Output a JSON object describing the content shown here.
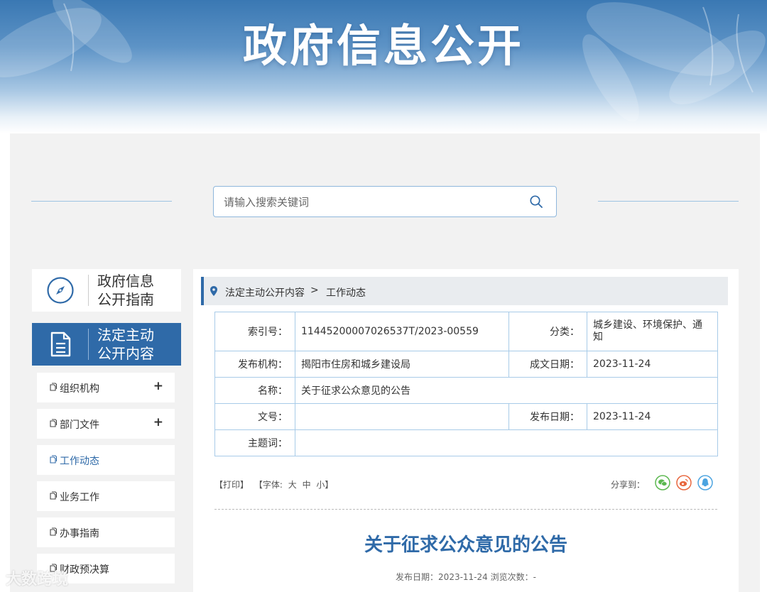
{
  "banner": {
    "title": "政府信息公开"
  },
  "search": {
    "placeholder": "请输入搜索关键词"
  },
  "sidebar": {
    "cards": [
      {
        "label_line1": "政府信息",
        "label_line2": "公开指南"
      },
      {
        "label_line1": "法定主动",
        "label_line2": "公开内容"
      }
    ],
    "items": [
      {
        "label": "组织机构",
        "expand": "+"
      },
      {
        "label": "部门文件",
        "expand": "+"
      },
      {
        "label": "工作动态"
      },
      {
        "label": "业务工作"
      },
      {
        "label": "办事指南"
      },
      {
        "label": "财政预决算"
      }
    ]
  },
  "breadcrumb": {
    "parent": "法定主动公开内容",
    "separator": ">",
    "current": "工作动态"
  },
  "info": {
    "index_label": "索引号：",
    "index_value": "11445200007026537T/2023-00559",
    "category_label": "分类：",
    "category_value": "城乡建设、环境保护、通知",
    "publisher_label": "发布机构：",
    "publisher_value": "揭阳市住房和城乡建设局",
    "created_label": "成文日期：",
    "created_value": "2023-11-24",
    "name_label": "名称：",
    "name_value": "关于征求公众意见的公告",
    "docno_label": "文号：",
    "docno_value": "",
    "pubdate_label": "发布日期：",
    "pubdate_value": "2023-11-24",
    "subject_label": "主题词：",
    "subject_value": ""
  },
  "tools": {
    "print": "【打印】",
    "font_label": "【字体:",
    "font_large": "大",
    "font_medium": "中",
    "font_small": "小】",
    "share_label": "分享到："
  },
  "article": {
    "title": "关于征求公众意见的公告",
    "meta": "发布日期：2023-11-24  浏览次数：-"
  },
  "watermark": "大数跨境",
  "colors": {
    "accent": "#2f6aa8",
    "wechat": "#5bb84f",
    "weibo": "#e8663d",
    "qq": "#4aa3e0"
  }
}
